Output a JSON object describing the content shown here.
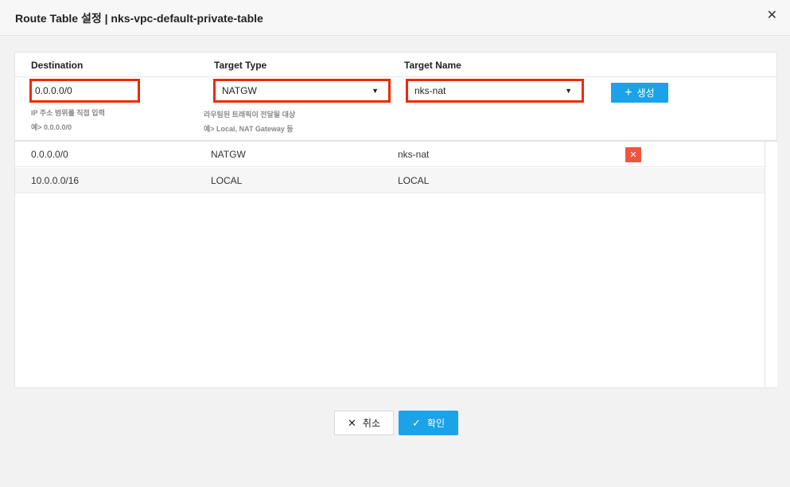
{
  "dialog": {
    "title": "Route Table 설정 | nks-vpc-default-private-table",
    "close_icon": "close-icon"
  },
  "columns": {
    "destination": "Destination",
    "target_type": "Target Type",
    "target_name": "Target Name"
  },
  "form": {
    "destination_value": "0.0.0.0/0",
    "destination_hint_1": "IP 주소 범위를 직접 입력",
    "destination_hint_2": "예> 0.0.0.0/0",
    "target_type_value": "NATGW",
    "target_type_hint_1": "라우팅된 트래픽이 전달될 대상",
    "target_type_hint_2": "예> Local, NAT Gateway 등",
    "target_name_value": "nks-nat",
    "create_label": "생성"
  },
  "rows": [
    {
      "destination": "0.0.0.0/0",
      "target_type": "NATGW",
      "target_name": "nks-nat",
      "deletable": true
    },
    {
      "destination": "10.0.0.0/16",
      "target_type": "LOCAL",
      "target_name": "LOCAL",
      "deletable": false
    }
  ],
  "footer": {
    "cancel_label": "취소",
    "ok_label": "확인"
  },
  "colors": {
    "accent": "#1aa3e8",
    "highlight_border": "#ee2a00",
    "delete": "#ee5540"
  }
}
